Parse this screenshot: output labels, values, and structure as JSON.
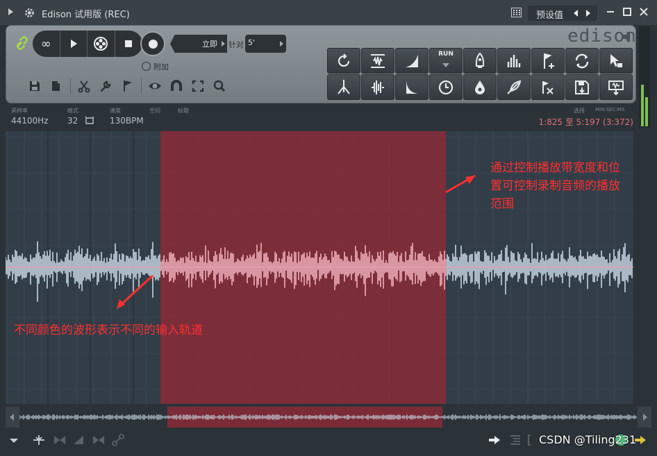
{
  "window": {
    "title": "Edison 试用版 (REC)",
    "preset_label": "预设值"
  },
  "controls": {
    "loop_label": "∞",
    "record_mode": "立即",
    "needle_label": "针对",
    "needle_value": "5'",
    "attach_label": "附加",
    "logo": "edison"
  },
  "info": {
    "sample_rate_label": "采样率",
    "sample_rate": "44100Hz",
    "format_label": "格式",
    "format": "32",
    "tempo_label": "速度",
    "tempo": "130BPM",
    "space_label": "空间",
    "title_label": "标题",
    "selection_label": "选择",
    "time_format_label": "MIN:SEC:MS",
    "selection": "1:825 至 5:197 (3:372)"
  },
  "annotations": {
    "top": [
      "通过控制播放带宽度和位",
      "置可控制录制音频的播放",
      "范围"
    ],
    "bottom": "不同颜色的波形表示不同的输入轨道"
  },
  "watermark": "CSDN @Tiling231",
  "colors": {
    "selection": "#8a2a38",
    "waveform": "#c9d8e4",
    "waveform_selected": "#f0b0bc",
    "annotation": "#ff3030",
    "meter": "#7fc050"
  },
  "icons": {
    "toolbar": [
      "floppy-icon",
      "clipboard-icon",
      "scissors-icon",
      "wrench-icon",
      "flag-icon",
      "eye-icon",
      "magnet-icon",
      "brackets-icon",
      "zoom-icon"
    ],
    "tool_grid": [
      "refresh-icon",
      "normalize-icon",
      "fade-icon",
      "run-icon",
      "rocket-icon",
      "equalizer-icon",
      "add-marker-icon",
      "loop-icon",
      "cursor-icon",
      "tuning-fork-icon",
      "amplify-icon",
      "decay-icon",
      "clock-icon",
      "drop-icon",
      "feather-icon",
      "marker-flag-icon",
      "save-icon",
      "export-icon"
    ]
  }
}
